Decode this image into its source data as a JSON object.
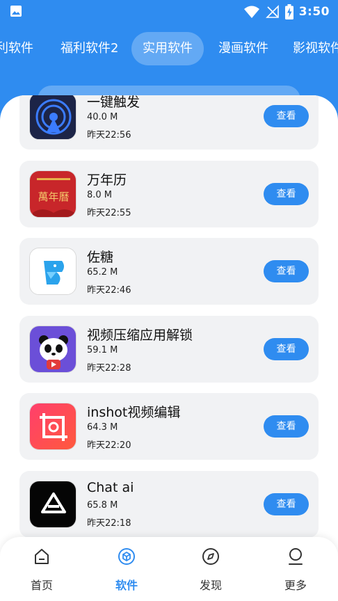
{
  "status_bar": {
    "time": "3:50"
  },
  "tabs": [
    {
      "label": "利软件"
    },
    {
      "label": "福利软件2"
    },
    {
      "label": "实用软件"
    },
    {
      "label": "漫画软件"
    },
    {
      "label": "影视软件"
    }
  ],
  "apps": [
    {
      "name": "一键触发",
      "size": "40.0 M",
      "time": "昨天22:56",
      "button": "查看",
      "icon": "broadcast-icon"
    },
    {
      "name": "万年历",
      "size": "8.0 M",
      "time": "昨天22:55",
      "button": "查看",
      "icon": "calendar-icon",
      "icon_text": "萬年曆"
    },
    {
      "name": "佐糖",
      "size": "65.2 M",
      "time": "昨天22:46",
      "button": "查看",
      "icon": "bird-icon"
    },
    {
      "name": "视频压缩应用解锁",
      "size": "59.1 M",
      "time": "昨天22:28",
      "button": "查看",
      "icon": "panda-icon"
    },
    {
      "name": "inshot视频编辑",
      "size": "64.3 M",
      "time": "昨天22:20",
      "button": "查看",
      "icon": "crop-icon"
    },
    {
      "name": "Chat ai",
      "size": "65.8 M",
      "time": "昨天22:18",
      "button": "查看",
      "icon": "chat-ai-logo-icon"
    }
  ],
  "bottom_nav": [
    {
      "label": "首页",
      "icon": "home-icon"
    },
    {
      "label": "软件",
      "icon": "cube-icon",
      "active": true
    },
    {
      "label": "发现",
      "icon": "compass-icon"
    },
    {
      "label": "更多",
      "icon": "user-icon"
    }
  ],
  "colors": {
    "primary": "#2f8cf0",
    "card_bg": "#f1f2f4"
  }
}
